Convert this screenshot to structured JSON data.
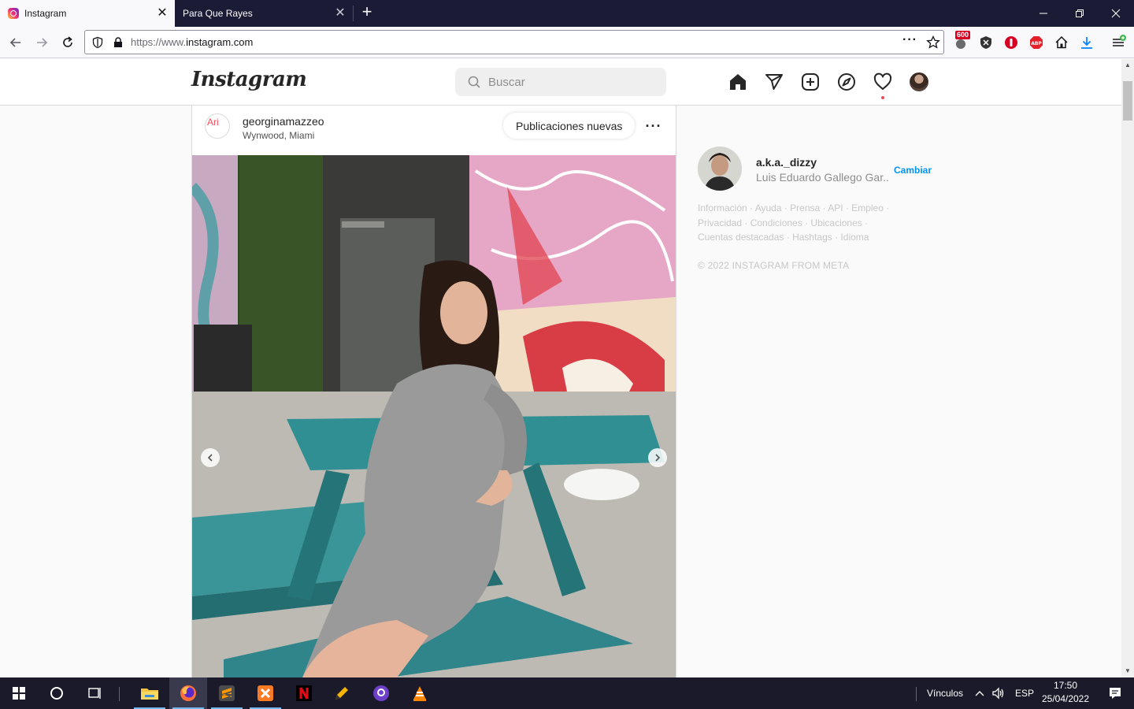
{
  "browser": {
    "tabs": [
      {
        "title": "Instagram",
        "active": true
      },
      {
        "title": "Para Que Rayes",
        "active": false
      }
    ],
    "url_prefix": "https://www.",
    "url_host": "instagram.com",
    "badge_count": "600"
  },
  "instagram": {
    "logo": "Instagram",
    "search_placeholder": "Buscar",
    "post": {
      "avatar_alt": "Ari",
      "username": "georginamazzeo",
      "location": "Wynwood, Miami",
      "new_posts_pill": "Publicaciones nuevas",
      "more_label": "···"
    },
    "sidebar": {
      "username": "a.k.a._dizzy",
      "full_name": "Luis Eduardo Gallego Gar...",
      "switch_label": "Cambiar",
      "footer_lines": [
        "Información · Ayuda · Prensa · API · Empleo ·",
        "Privacidad · Condiciones · Ubicaciones ·",
        "Cuentas destacadas · Hashtags · Idioma"
      ],
      "copyright": "© 2022 INSTAGRAM FROM META"
    }
  },
  "taskbar": {
    "links_label": "Vínculos",
    "language": "ESP",
    "time": "17:50",
    "date": "25/04/2022"
  },
  "colors": {
    "ig_blue": "#0095f6",
    "notif_red": "#ed4956",
    "tab_strip": "#1c1b36",
    "taskbar": "#1a1a2a"
  }
}
